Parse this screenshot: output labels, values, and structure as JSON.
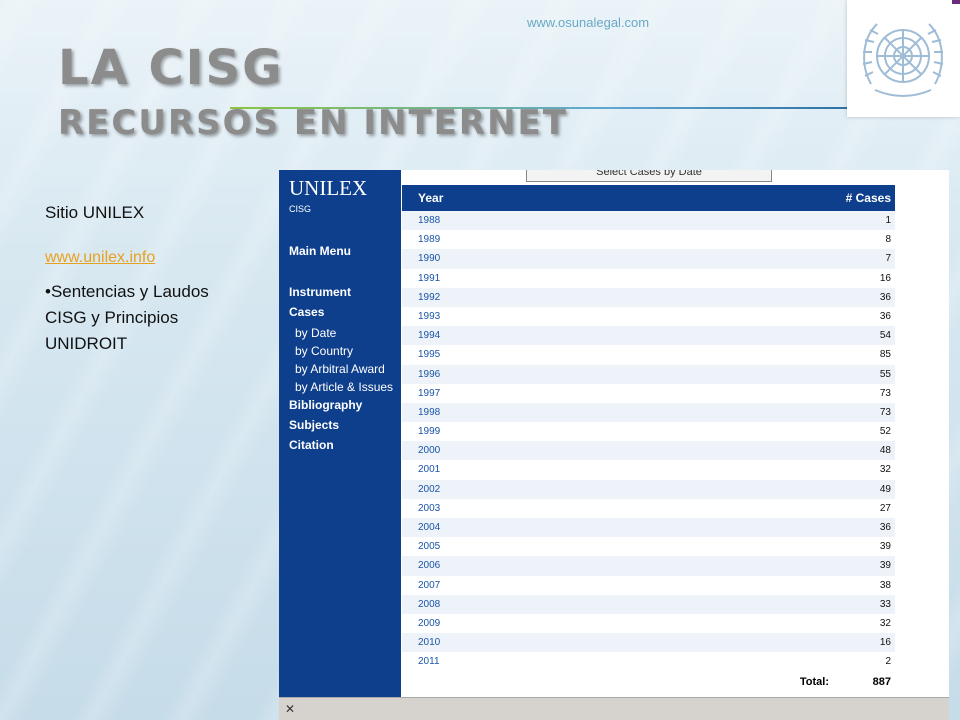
{
  "slide": {
    "website": "www.osunalegal.com",
    "title": "La CISG",
    "subtitle": "Recursos en internet"
  },
  "side": {
    "heading": "Sitio UNILEX",
    "link": "www.unilex.info",
    "bullet": "•Sentencias y Laudos CISG y Principios UNIDROIT"
  },
  "screenshot": {
    "brand": "UNILEX",
    "brand_sub": "CISG",
    "select_button": "Select Cases by Date",
    "menu": {
      "main": "Main Menu",
      "instrument": "Instrument",
      "cases": "Cases",
      "by_date": "by Date",
      "by_country": "by Country",
      "by_award": "by Arbitral Award",
      "by_article": "by Article & Issues",
      "bibliography": "Bibliography",
      "subjects": "Subjects",
      "citation": "Citation"
    },
    "table": {
      "col_year": "Year",
      "col_cases": "# Cases",
      "rows": [
        {
          "year": "1988",
          "cases": "1"
        },
        {
          "year": "1989",
          "cases": "8"
        },
        {
          "year": "1990",
          "cases": "7"
        },
        {
          "year": "1991",
          "cases": "16"
        },
        {
          "year": "1992",
          "cases": "36"
        },
        {
          "year": "1993",
          "cases": "36"
        },
        {
          "year": "1994",
          "cases": "54"
        },
        {
          "year": "1995",
          "cases": "85"
        },
        {
          "year": "1996",
          "cases": "55"
        },
        {
          "year": "1997",
          "cases": "73"
        },
        {
          "year": "1998",
          "cases": "73"
        },
        {
          "year": "1999",
          "cases": "52"
        },
        {
          "year": "2000",
          "cases": "48"
        },
        {
          "year": "2001",
          "cases": "32"
        },
        {
          "year": "2002",
          "cases": "49"
        },
        {
          "year": "2003",
          "cases": "27"
        },
        {
          "year": "2004",
          "cases": "36"
        },
        {
          "year": "2005",
          "cases": "39"
        },
        {
          "year": "2006",
          "cases": "39"
        },
        {
          "year": "2007",
          "cases": "38"
        },
        {
          "year": "2008",
          "cases": "33"
        },
        {
          "year": "2009",
          "cases": "32"
        },
        {
          "year": "2010",
          "cases": "16"
        },
        {
          "year": "2011",
          "cases": "2"
        }
      ],
      "total_label": "Total:",
      "total_value": "887"
    },
    "close_glyph": "✕"
  },
  "icons": {
    "logo": "un-emblem-icon",
    "close": "close-icon"
  }
}
